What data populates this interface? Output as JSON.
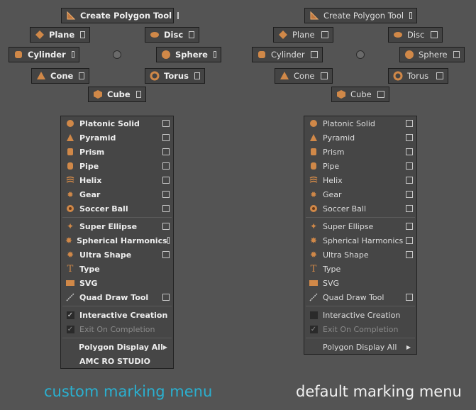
{
  "colors": {
    "background": "#545454",
    "custom_caption": "#2ab0d0",
    "default_caption": "#f2f2f2",
    "icon_orange": "#e0a060"
  },
  "menus": [
    {
      "id": "custom",
      "radial": {
        "create_polygon": "Create Polygon Tool",
        "plane": "Plane",
        "disc": "Disc",
        "cylinder": "Cylinder",
        "sphere": "Sphere",
        "cone": "Cone",
        "torus": "Torus",
        "cube": "Cube"
      },
      "list": [
        {
          "label": "Platonic Solid",
          "icon": "platonic-solid-icon",
          "checkbox": true
        },
        {
          "label": "Pyramid",
          "icon": "pyramid-icon",
          "checkbox": true
        },
        {
          "label": "Prism",
          "icon": "prism-icon",
          "checkbox": true
        },
        {
          "label": "Pipe",
          "icon": "pipe-icon",
          "checkbox": true
        },
        {
          "label": "Helix",
          "icon": "helix-icon",
          "checkbox": true
        },
        {
          "label": "Gear",
          "icon": "gear-icon",
          "checkbox": true
        },
        {
          "label": "Soccer Ball",
          "icon": "soccer-ball-icon",
          "checkbox": true
        },
        {
          "label": "Super Ellipse",
          "icon": "super-ellipse-icon",
          "checkbox": true
        },
        {
          "label": "Spherical Harmonics",
          "icon": "spherical-harmonics-icon",
          "checkbox": true
        },
        {
          "label": "Ultra Shape",
          "icon": "ultra-shape-icon",
          "checkbox": true
        },
        {
          "label": "Type",
          "icon": "type-icon",
          "checkbox": false
        },
        {
          "label": "SVG",
          "icon": "svg-icon",
          "checkbox": false
        },
        {
          "label": "Quad Draw Tool",
          "icon": "quad-draw-icon",
          "checkbox": true
        },
        {
          "label": "Interactive Creation",
          "icon": "checked-icon",
          "checked": true
        },
        {
          "label": "Exit On Completion",
          "icon": "checked-icon",
          "checked": true,
          "disabled": true
        },
        {
          "label": "Polygon Display All",
          "submenu": true
        },
        {
          "label": "AMC RO STUDIO"
        }
      ],
      "caption": "custom marking menu"
    },
    {
      "id": "default",
      "radial": {
        "create_polygon": "Create Polygon Tool",
        "plane": "Plane",
        "disc": "Disc",
        "cylinder": "Cylinder",
        "sphere": "Sphere",
        "cone": "Cone",
        "torus": "Torus",
        "cube": "Cube"
      },
      "list": [
        {
          "label": "Platonic Solid",
          "icon": "platonic-solid-icon",
          "checkbox": true
        },
        {
          "label": "Pyramid",
          "icon": "pyramid-icon",
          "checkbox": true
        },
        {
          "label": "Prism",
          "icon": "prism-icon",
          "checkbox": true
        },
        {
          "label": "Pipe",
          "icon": "pipe-icon",
          "checkbox": true
        },
        {
          "label": "Helix",
          "icon": "helix-icon",
          "checkbox": true
        },
        {
          "label": "Gear",
          "icon": "gear-icon",
          "checkbox": true
        },
        {
          "label": "Soccer Ball",
          "icon": "soccer-ball-icon",
          "checkbox": true
        },
        {
          "label": "Super Ellipse",
          "icon": "super-ellipse-icon",
          "checkbox": true
        },
        {
          "label": "Spherical Harmonics",
          "icon": "spherical-harmonics-icon",
          "checkbox": true
        },
        {
          "label": "Ultra Shape",
          "icon": "ultra-shape-icon",
          "checkbox": true
        },
        {
          "label": "Type",
          "icon": "type-icon",
          "checkbox": false
        },
        {
          "label": "SVG",
          "icon": "svg-icon",
          "checkbox": false
        },
        {
          "label": "Quad Draw Tool",
          "icon": "quad-draw-icon",
          "checkbox": true
        },
        {
          "label": "Interactive Creation",
          "icon": "unchecked-icon",
          "checked": false
        },
        {
          "label": "Exit On Completion",
          "icon": "checked-icon",
          "checked": true,
          "disabled": true
        },
        {
          "label": "Polygon Display All",
          "submenu": true
        }
      ],
      "caption": "default marking menu"
    }
  ]
}
